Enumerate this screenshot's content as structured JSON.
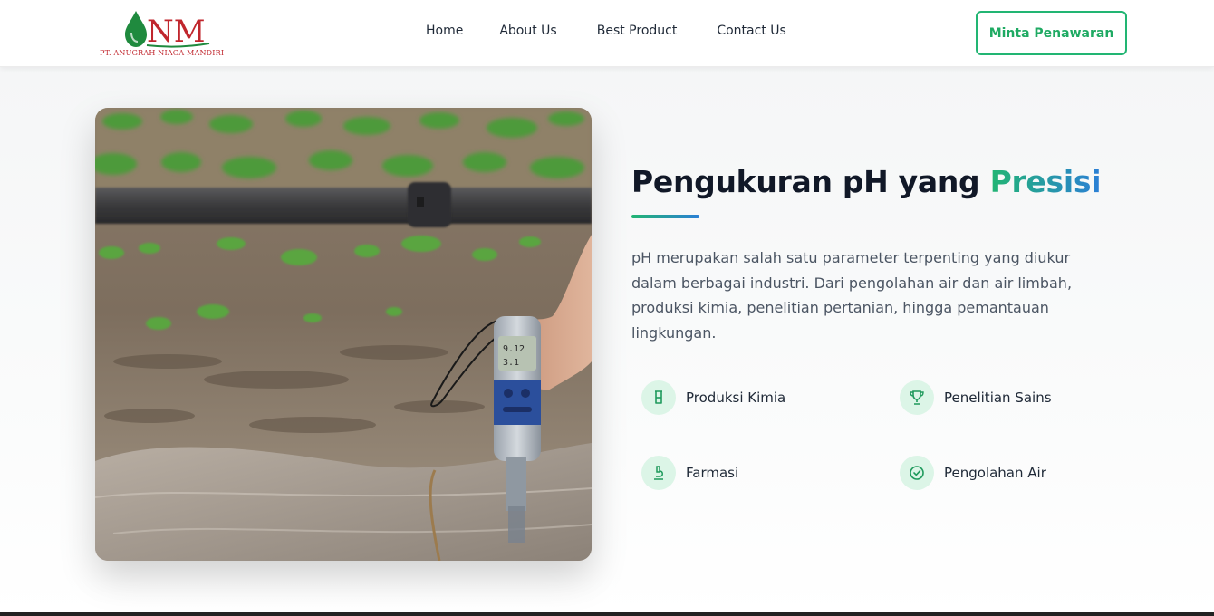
{
  "header": {
    "logo_initials": "NM",
    "logo_company": "PT. Anugrah Niaga Mandiri",
    "nav": [
      {
        "label": "Home"
      },
      {
        "label": "About Us"
      },
      {
        "label": "Best Product"
      },
      {
        "label": "Contact Us"
      }
    ],
    "cta_label": "Minta Penawaran"
  },
  "hero": {
    "headline_main": "Pengukuran pH yang ",
    "headline_accent": "Presisi",
    "description": "pH merupakan salah satu parameter terpenting yang diukur dalam berbagai industri. Dari pengolahan air dan air limbah, produksi kimia, penelitian pertanian, hingga pemantauan lingkungan.",
    "image_meter_reading_1": "9.12",
    "image_meter_reading_2": "3.1",
    "features": [
      {
        "label": "Produksi Kimia",
        "icon": "beaker-icon"
      },
      {
        "label": "Penelitian Sains",
        "icon": "trophy-icon"
      },
      {
        "label": "Farmasi",
        "icon": "microscope-icon"
      },
      {
        "label": "Pengolahan Air",
        "icon": "check-circle-icon"
      }
    ]
  },
  "colors": {
    "brand_green": "#22b573",
    "brand_blue": "#2b7fd6",
    "logo_red": "#c0262d",
    "icon_bg": "#dcf5e7"
  }
}
